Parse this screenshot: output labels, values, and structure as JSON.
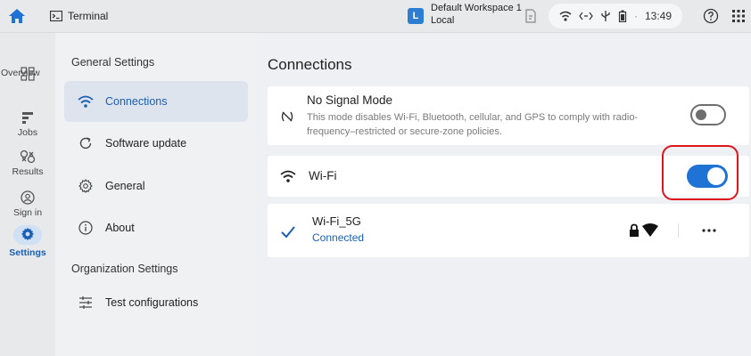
{
  "topbar": {
    "tab_title": "Terminal",
    "workspace_badge": "L",
    "workspace_name": "Default Workspace 1",
    "workspace_location": "Local",
    "time": "13:49",
    "separator": "·"
  },
  "rail": {
    "items": [
      {
        "label": "Overview",
        "icon": "overview-icon"
      },
      {
        "label": "Jobs",
        "icon": "jobs-icon"
      },
      {
        "label": "Results",
        "icon": "results-icon"
      },
      {
        "label": "Sign in",
        "icon": "sign-in-icon"
      },
      {
        "label": "Settings",
        "icon": "gear-icon",
        "active": true
      }
    ]
  },
  "nav": {
    "general_heading": "General Settings",
    "org_heading": "Organization Settings",
    "items": [
      {
        "label": "Connections",
        "icon": "wifi-icon",
        "active": true
      },
      {
        "label": "Software update",
        "icon": "update-icon"
      },
      {
        "label": "General",
        "icon": "gear-icon"
      },
      {
        "label": "About",
        "icon": "info-icon"
      },
      {
        "label": "Test configurations",
        "icon": "sliders-icon"
      }
    ]
  },
  "main": {
    "title": "Connections",
    "no_signal": {
      "title": "No Signal Mode",
      "description": "This mode disables Wi-Fi, Bluetooth, cellular, and GPS to comply with radio-frequency–restricted or secure-zone policies.",
      "enabled": false
    },
    "wifi": {
      "label": "Wi-Fi",
      "enabled": true
    },
    "network": {
      "ssid": "Wi-Fi_5G",
      "status": "Connected",
      "secured": true
    }
  },
  "colors": {
    "accent": "#1f73d4",
    "highlight": "#e0141b",
    "active_nav": "#dde4ee"
  }
}
